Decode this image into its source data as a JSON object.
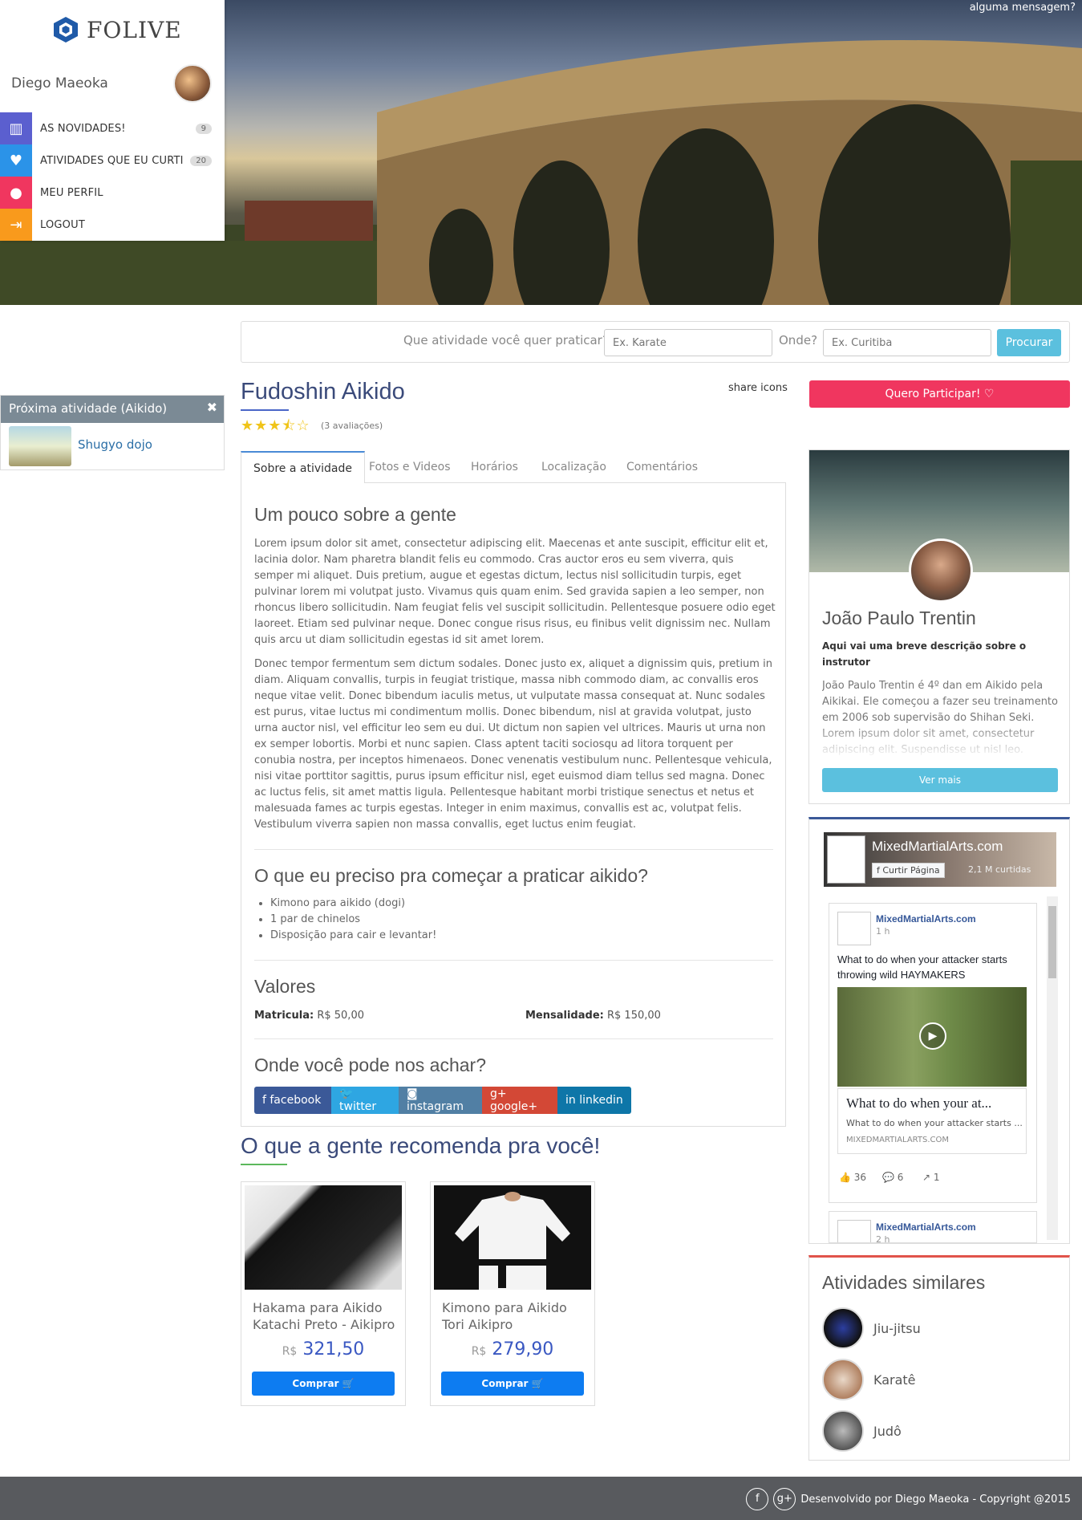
{
  "hero": {
    "message": "alguma mensagem?"
  },
  "brand": {
    "name": "FOLIVE",
    "accent": "#2a6fb5"
  },
  "user": {
    "name": "Diego Maeoka"
  },
  "nav": [
    {
      "label": "AS NOVIDADES!",
      "badge": "9",
      "icon": "map-icon",
      "color": "#5b5fcf"
    },
    {
      "label": "ATIVIDADES QUE EU CURTI",
      "badge": "20",
      "icon": "heart-icon",
      "color": "#2b93e8"
    },
    {
      "label": "MEU PERFIL",
      "badge": "",
      "icon": "user-icon",
      "color": "#f0365f"
    },
    {
      "label": "LOGOUT",
      "badge": "",
      "icon": "logout-icon",
      "color": "#f99a1c"
    }
  ],
  "next_activity": {
    "header": "Próxima atividade (Aikido)",
    "name": "Shugyo dojo"
  },
  "search": {
    "question": "Que atividade você quer praticar?",
    "activity_placeholder": "Ex. Karate",
    "where_label": "Onde?",
    "where_placeholder": "Ex. Curitiba",
    "button": "Procurar"
  },
  "activity": {
    "title": "Fudoshin Aikido",
    "rating": 3.5,
    "stars": "★★★⯪☆",
    "reviews": "(3 avaliações)",
    "share": "share icons",
    "join_button": "Quero Participar! ♡"
  },
  "tabs": [
    "Sobre a atividade",
    "Fotos e Videos",
    "Horários",
    "Localização",
    "Comentários"
  ],
  "about": {
    "heading": "Um pouco sobre a gente",
    "p1": "Lorem ipsum dolor sit amet, consectetur adipiscing elit. Maecenas et ante suscipit, efficitur elit et, lacinia dolor. Nam pharetra blandit felis eu commodo. Cras auctor eros eu sem viverra, quis semper mi aliquet. Duis pretium, augue et egestas dictum, lectus nisl sollicitudin turpis, eget pulvinar lorem mi volutpat justo. Vivamus quis quam enim. Sed gravida sapien a leo semper, non rhoncus libero sollicitudin. Nam feugiat felis vel suscipit sollicitudin. Pellentesque posuere odio eget laoreet. Etiam sed pulvinar neque. Donec congue risus risus, eu finibus velit dignissim nec. Nullam quis arcu ut diam sollicitudin egestas id sit amet lorem.",
    "p2": "Donec tempor fermentum sem dictum sodales. Donec justo ex, aliquet a dignissim quis, pretium in diam. Aliquam convallis, turpis in feugiat tristique, massa nibh commodo diam, ac convallis eros neque vitae velit. Donec bibendum iaculis metus, ut vulputate massa consequat at. Nunc sodales est purus, vitae luctus mi condimentum mollis. Donec bibendum, nisl at gravida volutpat, justo urna auctor nisl, vel efficitur leo sem eu dui. Ut dictum non sapien vel ultrices. Mauris ut urna non ex semper lobortis. Morbi et nunc sapien. Class aptent taciti sociosqu ad litora torquent per conubia nostra, per inceptos himenaeos. Donec venenatis vestibulum nunc. Pellentesque vehicula, nisi vitae porttitor sagittis, purus ipsum efficitur nisl, eget euismod diam tellus sed magna. Donec ac luctus felis, sit amet mattis ligula. Pellentesque habitant morbi tristique senectus et netus et malesuada fames ac turpis egestas. Integer in enim maximus, convallis est ac, volutpat felis. Vestibulum viverra sapien non massa convallis, eget luctus enim feugiat."
  },
  "needs": {
    "heading": "O que eu preciso pra começar a praticar aikido?",
    "items": [
      "Kimono para aikido (dogi)",
      "1 par de chinelos",
      "Disposição para cair e levantar!"
    ]
  },
  "prices": {
    "heading": "Valores",
    "enroll_label": "Matricula:",
    "enroll_value": "R$ 50,00",
    "monthly_label": "Mensalidade:",
    "monthly_value": "R$ 150,00"
  },
  "find": {
    "heading": "Onde você pode nos achar?",
    "links": [
      {
        "label": "f facebook",
        "color": "#3b5998"
      },
      {
        "label": "🐦 twitter",
        "color": "#2ea6e2"
      },
      {
        "label": "◙ instagram",
        "color": "#517fa4"
      },
      {
        "label": "g+ google+",
        "color": "#d34836"
      },
      {
        "label": "in linkedin",
        "color": "#0e76a8"
      }
    ]
  },
  "recommend": {
    "heading": "O que a gente recomenda pra você!",
    "products": [
      {
        "name": "Hakama para Aikido Katachi Preto - Aikipro",
        "currency": "R$",
        "price": "321,50",
        "button": "Comprar 🛒"
      },
      {
        "name": "Kimono para Aikido Tori Aikipro",
        "currency": "R$",
        "price": "279,90",
        "button": "Comprar 🛒"
      }
    ]
  },
  "instructor": {
    "name": "João Paulo Trentin",
    "subtitle": "Aqui vai uma breve descrição sobre o instrutor",
    "description": "João Paulo Trentin é 4º dan em Aikido pela Aikikai. Ele começou a fazer seu treinamento em 2006 sob supervisão do Shihan Seki. Lorem ipsum dolor sit amet, consectetur adipiscing elit. Suspendisse ut nisl leo. Integer volutpat",
    "button": "Ver mais"
  },
  "facebook": {
    "page": "MixedMartialArts.com",
    "like": "Curtir Página",
    "likes": "2,1 M curtidas",
    "post_source": "MixedMartialArts.com",
    "post_time": "1 h",
    "post_text": "What to do when your attacker starts throwing wild HAYMAKERS",
    "link_title": "What to do when your at...",
    "link_desc": "What to do when your attacker starts ...",
    "link_domain": "MIXEDMARTIALARTS.COM",
    "likes_count": "36",
    "comments_count": "6",
    "shares_count": "1",
    "post2_source": "MixedMartialArts.com",
    "post2_time": "2 h"
  },
  "similar": {
    "heading": "Atividades similares",
    "items": [
      "Jiu-jitsu",
      "Karatê",
      "Judô"
    ]
  },
  "footer": {
    "text": "Desenvolvido por Diego Maeoka - Copyright @2015"
  }
}
